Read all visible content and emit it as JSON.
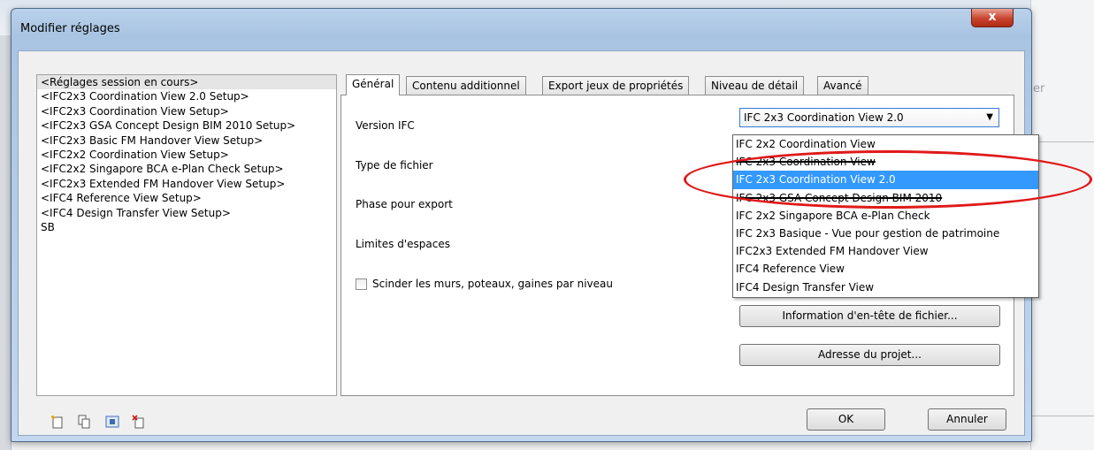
{
  "window": {
    "title": "Modifier réglages",
    "close_label": "x"
  },
  "setups": [
    "<Réglages session en cours>",
    "<IFC2x3 Coordination View 2.0 Setup>",
    "<IFC2x3 Coordination View Setup>",
    "<IFC2x3 GSA Concept Design BIM 2010 Setup>",
    "<IFC2x3 Basic FM Handover View Setup>",
    "<IFC2x2 Coordination View Setup>",
    "<IFC2x2 Singapore BCA e-Plan Check Setup>",
    "<IFC2x3 Extended FM Handover View Setup>",
    "<IFC4 Reference View Setup>",
    "<IFC4 Design Transfer View Setup>",
    "SB"
  ],
  "tabs": [
    "Général",
    "Contenu additionnel",
    "Export jeux de propriétés",
    "Niveau de détail",
    "Avancé"
  ],
  "general": {
    "version_label": "Version IFC",
    "file_type_label": "Type de fichier",
    "phase_label": "Phase pour export",
    "space_bounds_label": "Limites d'espaces",
    "split_walls_label": "Scinder les murs, poteaux, gaines par niveau"
  },
  "version_combo": {
    "selected": "IFC 2x3 Coordination View 2.0",
    "options": [
      "IFC 2x2 Coordination View",
      "IFC 2x3 Coordination View",
      "IFC 2x3 Coordination View 2.0",
      "IFC 2x3 GSA Concept Design BIM 2010",
      "IFC 2x2 Singapore BCA e-Plan Check",
      "IFC 2x3 Basique - Vue pour gestion de patrimoine",
      "IFC2x3 Extended FM Handover View",
      "IFC4 Reference View",
      "IFC4 Design Transfer View"
    ]
  },
  "buttons": {
    "file_header": "Information d'en-tête de fichier...",
    "project_address": "Adresse du projet...",
    "ok": "OK",
    "cancel": "Annuler"
  },
  "colors": {
    "selection": "#3399ff",
    "annotation": "#e01919"
  }
}
